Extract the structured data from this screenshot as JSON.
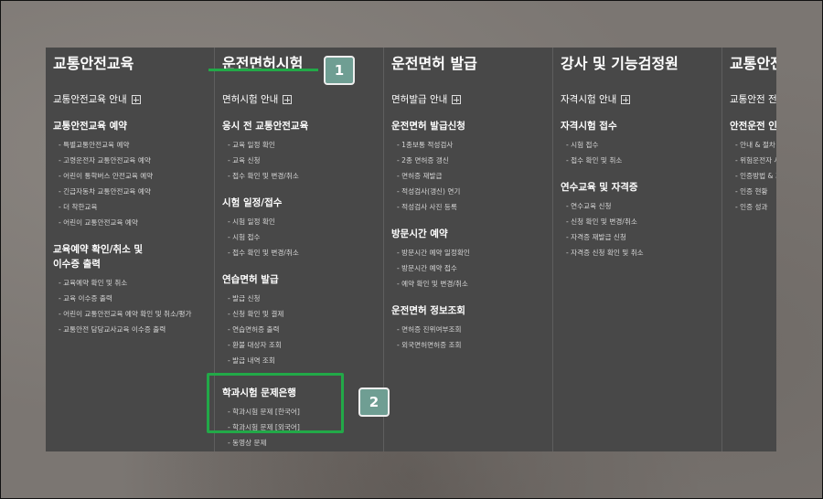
{
  "columns": [
    {
      "title": "교통안전교육",
      "guide": "교통안전교육 안내",
      "sections": [
        {
          "title": "교통안전교육 예약",
          "items": [
            "특별교통안전교육 예약",
            "고령운전자 교통안전교육 예약",
            "어린이 통학버스 안전교육 예약",
            "긴급자동차 교통안전교육 예약",
            "더 착한교육",
            "어린이 교통안전교육 예약"
          ]
        },
        {
          "title_lines": [
            "교육예약 확인/취소 및",
            "이수증 출력"
          ],
          "items": [
            "교육예약 확인 및 취소",
            "교육 이수증 출력",
            "어린이 교통안전교육 예약 확인 및 취소/평가",
            "교통안전 담당교사교육 이수증 출력"
          ]
        }
      ]
    },
    {
      "title": "운전면허시험",
      "guide": "면허시험 안내",
      "sections": [
        {
          "title": "응시 전 교통안전교육",
          "items": [
            "교육 일정 확인",
            "교육 신청",
            "접수 확인 및 변경/취소"
          ]
        },
        {
          "title": "시험 일정/접수",
          "items": [
            "시험 일정 확인",
            "시험 접수",
            "접수 확인 및 변경/취소"
          ]
        },
        {
          "title": "연습면허 발급",
          "items": [
            "발급 신청",
            "신청 확인 및 결제",
            "연습면허증 출력",
            "환불 대상자 조회",
            "발급 내역 조회"
          ]
        },
        {
          "title": "학과시험 문제은행",
          "items": [
            "학과시험 문제 [한국어]",
            "학과시험 문제 [외국어]",
            "동영상 문제"
          ]
        }
      ]
    },
    {
      "title": "운전면허 발급",
      "guide": "면허발급 안내",
      "sections": [
        {
          "title": "운전면허 발급신청",
          "items": [
            "1종보통 적성검사",
            "2종 면허증 갱신",
            "면허증 재발급",
            "적성검사(갱신) 연기",
            "적성검사 사진 등록"
          ]
        },
        {
          "title": "방문시간 예약",
          "items": [
            "방문시간 예약 일정확인",
            "방문시간 예약 접수",
            "예약 확인 및 변경/취소"
          ]
        },
        {
          "title": "운전면허 정보조회",
          "items": [
            "면허증 진위여부조회",
            "외국면허면허증 조회"
          ]
        }
      ]
    },
    {
      "title": "강사 및 기능검정원",
      "guide": "자격시험 안내",
      "sections": [
        {
          "title": "자격시험 접수",
          "items": [
            "시험 접수",
            "접수 확인 및 취소"
          ]
        },
        {
          "title": "연수교육 및 자격증",
          "items": [
            "연수교육 신청",
            "신청 확인 및 변경/취소",
            "자격증 재발급 신청",
            "자격증 신청 확인 및 취소"
          ]
        }
      ]
    },
    {
      "title": "교통안전",
      "guide": "교통안전 전",
      "sections": [
        {
          "title": "안전운전 인",
          "items": [
            "안내 & 절차",
            "위험운전자 사",
            "인증방법 & 기",
            "인증 현황",
            "인증 성과"
          ]
        }
      ]
    }
  ],
  "annotations": {
    "badge1": "1",
    "badge2": "2",
    "highlight_color": "#22a948",
    "badge_color": "#6f9e93"
  }
}
